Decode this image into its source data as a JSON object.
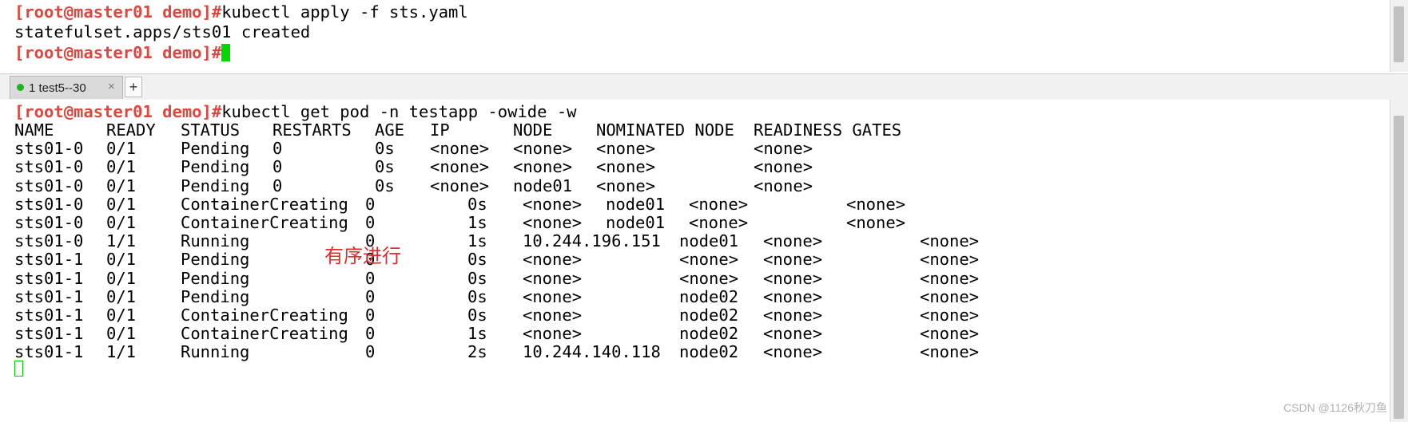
{
  "top_terminal": {
    "line1_prompt": "[root@master01 demo]#",
    "line1_command": "kubectl apply -f sts.yaml",
    "line2_output": "statefulset.apps/sts01 created",
    "line3_prompt": "[root@master01 demo]#"
  },
  "tab_bar": {
    "tab_label": "1 test5--30",
    "tab_close": "×",
    "new_tab": "+"
  },
  "bottom_terminal": {
    "prompt": "[root@master01 demo]#",
    "command": "kubectl get pod -n testapp -owide -w",
    "headers": {
      "name": "NAME",
      "ready": "READY",
      "status": "STATUS",
      "restarts": "RESTARTS",
      "age": "AGE",
      "ip": "IP",
      "node": "NODE",
      "nominated": "NOMINATED NODE",
      "readiness": "READINESS GATES"
    },
    "rows": [
      {
        "name": "sts01-0",
        "ready": "0/1",
        "status": "Pending",
        "restarts": "0",
        "age": "0s",
        "ip": "<none>",
        "node": "<none>",
        "nominated": "<none>",
        "readiness": "<none>"
      },
      {
        "name": "sts01-0",
        "ready": "0/1",
        "status": "Pending",
        "restarts": "0",
        "age": "0s",
        "ip": "<none>",
        "node": "<none>",
        "nominated": "<none>",
        "readiness": "<none>"
      },
      {
        "name": "sts01-0",
        "ready": "0/1",
        "status": "Pending",
        "restarts": "0",
        "age": "0s",
        "ip": "<none>",
        "node": "node01",
        "nominated": "<none>",
        "readiness": "<none>"
      },
      {
        "name": "sts01-0",
        "ready": "0/1",
        "status": "ContainerCreating",
        "restarts": "0",
        "age": "0s",
        "ip": "<none>",
        "node": "node01",
        "nominated": "<none>",
        "readiness": "<none>"
      },
      {
        "name": "sts01-0",
        "ready": "0/1",
        "status": "ContainerCreating",
        "restarts": "0",
        "age": "1s",
        "ip": "<none>",
        "node": "node01",
        "nominated": "<none>",
        "readiness": "<none>"
      },
      {
        "name": "sts01-0",
        "ready": "1/1",
        "status": "Running",
        "restarts": "0",
        "age": "1s",
        "ip": "10.244.196.151",
        "node": "node01",
        "nominated": "<none>",
        "readiness": "<none>"
      },
      {
        "name": "sts01-1",
        "ready": "0/1",
        "status": "Pending",
        "restarts": "0",
        "age": "0s",
        "ip": "<none>",
        "node": "<none>",
        "nominated": "<none>",
        "readiness": "<none>"
      },
      {
        "name": "sts01-1",
        "ready": "0/1",
        "status": "Pending",
        "restarts": "0",
        "age": "0s",
        "ip": "<none>",
        "node": "<none>",
        "nominated": "<none>",
        "readiness": "<none>"
      },
      {
        "name": "sts01-1",
        "ready": "0/1",
        "status": "Pending",
        "restarts": "0",
        "age": "0s",
        "ip": "<none>",
        "node": "node02",
        "nominated": "<none>",
        "readiness": "<none>"
      },
      {
        "name": "sts01-1",
        "ready": "0/1",
        "status": "ContainerCreating",
        "restarts": "0",
        "age": "0s",
        "ip": "<none>",
        "node": "node02",
        "nominated": "<none>",
        "readiness": "<none>"
      },
      {
        "name": "sts01-1",
        "ready": "0/1",
        "status": "ContainerCreating",
        "restarts": "0",
        "age": "1s",
        "ip": "<none>",
        "node": "node02",
        "nominated": "<none>",
        "readiness": "<none>"
      },
      {
        "name": "sts01-1",
        "ready": "1/1",
        "status": "Running",
        "restarts": "0",
        "age": "2s",
        "ip": "10.244.140.118",
        "node": "node02",
        "nominated": "<none>",
        "readiness": "<none>"
      }
    ],
    "annotation": "有序进行"
  },
  "watermark": "CSDN @1126秋刀鱼",
  "colors": {
    "prompt": "#e0453e",
    "cursor": "#00d800",
    "annotation": "#e22b2b"
  }
}
